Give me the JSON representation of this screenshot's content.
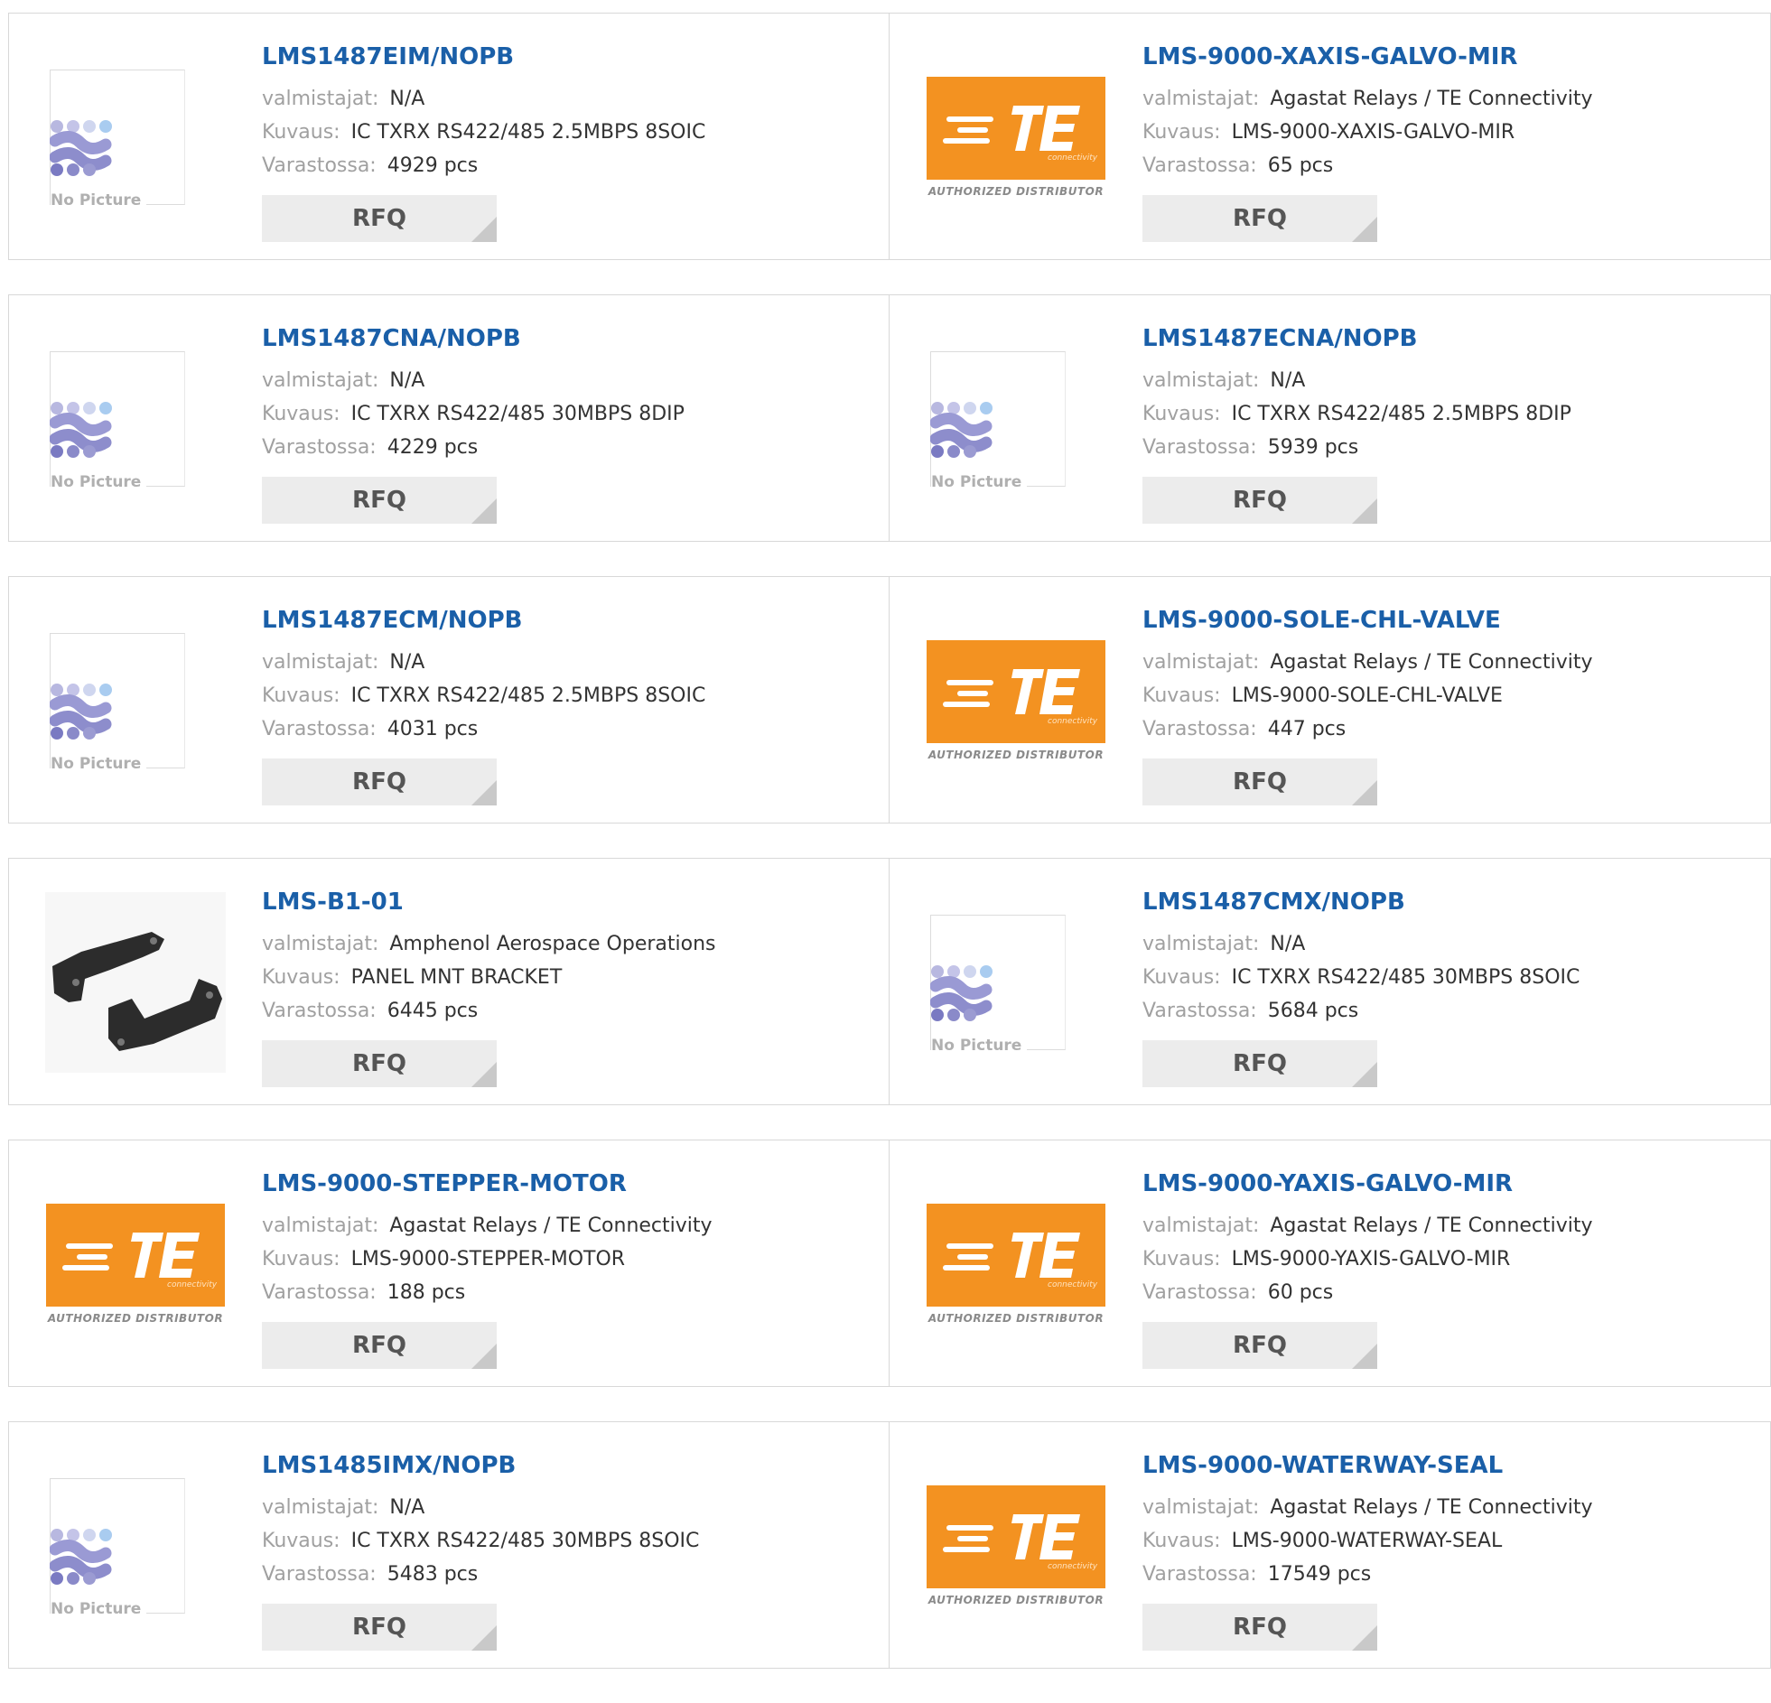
{
  "labels": {
    "manufacturer": "valmistajat:",
    "description": "Kuvaus:",
    "stock": "Varastossa:",
    "rfq": "RFQ",
    "no_picture": "No Picture",
    "te_caption": "AUTHORIZED DISTRIBUTOR",
    "te_sub": "connectivity"
  },
  "colors": {
    "title_link": "#1a5fa8",
    "te_orange": "#f39221",
    "rfq_bg": "#ececec"
  },
  "products": [
    {
      "part": "LMS1487EIM/NOPB",
      "image": "no-picture",
      "manufacturer": "N/A",
      "description": "IC TXRX RS422/485 2.5MBPS 8SOIC",
      "stock": "4929 pcs"
    },
    {
      "part": "LMS-9000-XAXIS-GALVO-MIR",
      "image": "te-logo",
      "manufacturer": "Agastat Relays / TE Connectivity",
      "description": "LMS-9000-XAXIS-GALVO-MIR",
      "stock": "65 pcs"
    },
    {
      "part": "LMS1487CNA/NOPB",
      "image": "no-picture",
      "manufacturer": "N/A",
      "description": "IC TXRX RS422/485 30MBPS 8DIP",
      "stock": "4229 pcs"
    },
    {
      "part": "LMS1487ECNA/NOPB",
      "image": "no-picture",
      "manufacturer": "N/A",
      "description": "IC TXRX RS422/485 2.5MBPS 8DIP",
      "stock": "5939 pcs"
    },
    {
      "part": "LMS1487ECM/NOPB",
      "image": "no-picture",
      "manufacturer": "N/A",
      "description": "IC TXRX RS422/485 2.5MBPS 8SOIC",
      "stock": "4031 pcs"
    },
    {
      "part": "LMS-9000-SOLE-CHL-VALVE",
      "image": "te-logo",
      "manufacturer": "Agastat Relays / TE Connectivity",
      "description": "LMS-9000-SOLE-CHL-VALVE",
      "stock": "447 pcs"
    },
    {
      "part": "LMS-B1-01",
      "image": "bracket-photo",
      "manufacturer": "Amphenol Aerospace Operations",
      "description": "PANEL MNT BRACKET",
      "stock": "6445 pcs"
    },
    {
      "part": "LMS1487CMX/NOPB",
      "image": "no-picture",
      "manufacturer": "N/A",
      "description": "IC TXRX RS422/485 30MBPS 8SOIC",
      "stock": "5684 pcs"
    },
    {
      "part": "LMS-9000-STEPPER-MOTOR",
      "image": "te-logo",
      "manufacturer": "Agastat Relays / TE Connectivity",
      "description": "LMS-9000-STEPPER-MOTOR",
      "stock": "188 pcs"
    },
    {
      "part": "LMS-9000-YAXIS-GALVO-MIR",
      "image": "te-logo",
      "manufacturer": "Agastat Relays / TE Connectivity",
      "description": "LMS-9000-YAXIS-GALVO-MIR",
      "stock": "60 pcs"
    },
    {
      "part": "LMS1485IMX/NOPB",
      "image": "no-picture",
      "manufacturer": "N/A",
      "description": "IC TXRX RS422/485 30MBPS 8SOIC",
      "stock": "5483 pcs"
    },
    {
      "part": "LMS-9000-WATERWAY-SEAL",
      "image": "te-logo",
      "manufacturer": "Agastat Relays / TE Connectivity",
      "description": "LMS-9000-WATERWAY-SEAL",
      "stock": "17549 pcs"
    }
  ]
}
